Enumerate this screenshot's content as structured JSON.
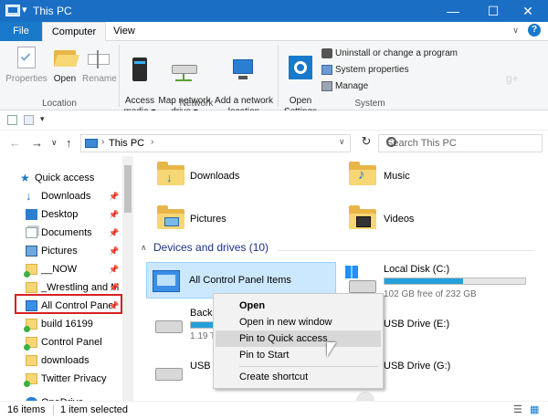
{
  "window": {
    "title": "This PC",
    "quick_access_glyph": "▾",
    "minimize": "—",
    "maximize": "☐",
    "close": "✕"
  },
  "tabs": [
    {
      "label": "File"
    },
    {
      "label": "Computer"
    },
    {
      "label": "View"
    }
  ],
  "help_glyph": "?",
  "collapse_glyph": "∨",
  "ribbon": {
    "location": {
      "group_label": "Location",
      "buttons": [
        {
          "label": "Properties",
          "icon": "checklist-icon"
        },
        {
          "label": "Open",
          "icon": "folder-open-icon"
        },
        {
          "label": "Rename",
          "icon": "rename-icon"
        }
      ]
    },
    "network": {
      "group_label": "Network",
      "buttons": [
        {
          "label": "Access\nmedia ▾",
          "icon": "media-server-icon"
        },
        {
          "label": "Map network\ndrive ▾",
          "icon": "network-drive-icon"
        },
        {
          "label": "Add a network\nlocation",
          "icon": "network-location-icon"
        }
      ]
    },
    "system": {
      "group_label": "System",
      "open_settings": "Open\nSettings",
      "items": [
        {
          "label": "Uninstall or change a program"
        },
        {
          "label": "System properties"
        },
        {
          "label": "Manage"
        }
      ]
    }
  },
  "qat_glyph": "▾",
  "address": {
    "back": "←",
    "forward": "→",
    "dropdown": "∨",
    "up": "↑",
    "crumb_sep": "›",
    "crumb": "This PC",
    "end_sep": "›",
    "dd": "∨",
    "refresh": "↻",
    "search_placeholder": "Search This PC"
  },
  "nav": {
    "items": [
      {
        "label": "Quick access",
        "icon": "star-icon",
        "pinned": false
      },
      {
        "label": "Downloads",
        "icon": "download-icon",
        "pinned": true
      },
      {
        "label": "Desktop",
        "icon": "desktop-icon",
        "pinned": true
      },
      {
        "label": "Documents",
        "icon": "documents-icon",
        "pinned": true
      },
      {
        "label": "Pictures",
        "icon": "pictures-icon",
        "pinned": true
      },
      {
        "label": "__NOW",
        "icon": "folder-sync-icon",
        "pinned": true
      },
      {
        "label": "_Wrestling and M",
        "icon": "folder-icon",
        "pinned": true
      },
      {
        "label": "All Control Panel",
        "icon": "control-panel-icon",
        "pinned": true
      },
      {
        "label": "build 16199",
        "icon": "folder-sync-icon",
        "pinned": false
      },
      {
        "label": "Control Panel",
        "icon": "folder-sync-icon",
        "pinned": false
      },
      {
        "label": "downloads",
        "icon": "folder-icon",
        "pinned": false
      },
      {
        "label": "Twitter Privacy",
        "icon": "folder-sync-icon",
        "pinned": false
      },
      {
        "label": "OneDrive",
        "icon": "cloud-icon",
        "pinned": false
      }
    ],
    "pin_glyph": "📌"
  },
  "folders": [
    {
      "label": "Downloads"
    },
    {
      "label": "Music"
    },
    {
      "label": "Pictures"
    },
    {
      "label": "Videos"
    }
  ],
  "devices": {
    "header": "Devices and drives (10)",
    "collapse_glyph": "∧",
    "items": [
      {
        "label": "All Control Panel Items"
      },
      {
        "label": "Local Disk (C:)",
        "free": "102 GB free of 232 GB",
        "used_fraction": 0.56
      },
      {
        "label": "Backu",
        "free": "1.19 T"
      },
      {
        "label": "USB Drive (E:)"
      },
      {
        "label": "USB D"
      },
      {
        "label": "USB Drive (G:)"
      }
    ]
  },
  "context_menu": {
    "items": [
      "Open",
      "Open in new window",
      "Pin to Quick access",
      "Pin to Start",
      "Create shortcut"
    ],
    "highlighted_index": 2
  },
  "status": {
    "items_count": "16 items",
    "selected": "1 item selected",
    "view_details_glyph": "☰",
    "view_tiles_glyph": "▦"
  },
  "watermark": "g+",
  "colors": {
    "titlebar": "#1a6fc4",
    "file_tab": "#1979ca",
    "selection": "#cce8ff",
    "highlight_box": "#d62020",
    "section_header": "#1e3287"
  }
}
